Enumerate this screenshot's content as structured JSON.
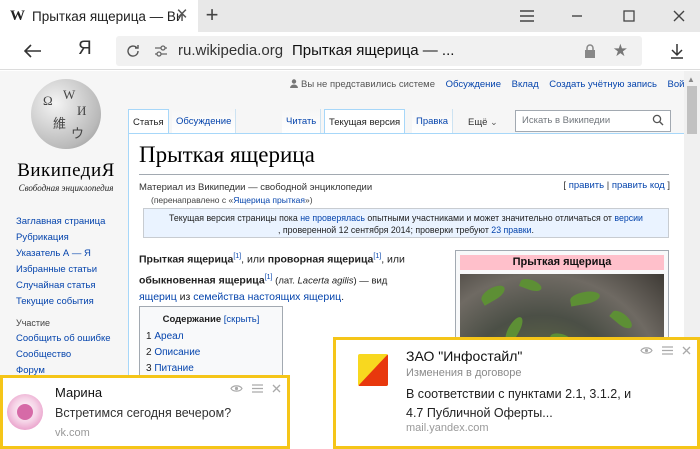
{
  "browser": {
    "tab_title": "Прыткая ящерица — Ви",
    "addr_domain": "ru.wikipedia.org",
    "addr_title": "Прыткая ящерица — ...",
    "yandex_button": "Я"
  },
  "wiki": {
    "wordmark": "ВикипедиЯ",
    "tagline": "Свободная энциклопедия",
    "nav_main": [
      "Заглавная страница",
      "Рубрикация",
      "Указатель А — Я",
      "Избранные статьи",
      "Случайная статья",
      "Текущие события"
    ],
    "nav_section": "Участие",
    "nav_participate": [
      "Сообщить об ошибке",
      "Сообщество",
      "Форум"
    ],
    "personal": {
      "not_logged": "Вы не представились системе",
      "talk": "Обсуждение",
      "contrib": "Вклад",
      "create": "Создать учётную запись",
      "login": "Войти"
    },
    "tabs": {
      "article": "Статья",
      "discussion": "Обсуждение",
      "read": "Читать",
      "current": "Текущая версия",
      "edit": "Правка",
      "more": "Ещё"
    },
    "search_placeholder": "Искать в Википедии",
    "title": "Прыткая ящерица",
    "from": "Материал из Википедии — свободной энциклопедии",
    "edit_links": {
      "open": "[",
      "edit": "править",
      "sep": "|",
      "edit_code": "править код",
      "close": "]"
    },
    "redirect": {
      "prefix": "(перенаправлено с «",
      "link": "Ящерица прыткая",
      "suffix": "»)"
    },
    "notice": {
      "t1": "Текущая версия страницы пока ",
      "l1": "не проверялась",
      "t2": " опытными участниками и может значительно отличаться от ",
      "l2": "версии",
      "t3": ", проверенной 12 сентября 2014; проверки требуют ",
      "l3": "23 правки",
      "t4": "."
    },
    "lede": {
      "b1": "Прыткая ящерица",
      "ref": "[1]",
      "t1": ", или ",
      "b2": "проворная ящерица",
      "t2": ", или",
      "b3": "обыкновенная ящерица",
      "lat_open": " (лат. ",
      "lat": "Lacerta agilis",
      "lat_close": ") — вид",
      "l1": "ящериц",
      "t3": " из ",
      "l2": "семейства настоящих ящериц",
      "t4": "."
    },
    "toc": {
      "title": "Содержание",
      "hide": "[скрыть]",
      "items": [
        {
          "num": "1",
          "label": "Ареал"
        },
        {
          "num": "2",
          "label": "Описание"
        },
        {
          "num": "3",
          "label": "Питание"
        }
      ]
    },
    "infobox_title": "Прыткая ящерица"
  },
  "notifications": {
    "vk": {
      "title": "Марина",
      "body": "Встретимся сегодня вечером?",
      "source": "vk.com"
    },
    "mail": {
      "title": "ЗАО \"Инфостайл\"",
      "subtitle": "Изменения в договоре",
      "body_line1": "В соответствии с пунктами 2.1, 3.1.2,  и",
      "body_line2": "4.7 Публичной Оферты...",
      "source": "mail.yandex.com"
    }
  },
  "colors": {
    "notification_border": "#f5c518",
    "wiki_link": "#0645ad",
    "infobox_header": "#ffc0cb",
    "notice_bg": "#eaf3ff"
  }
}
